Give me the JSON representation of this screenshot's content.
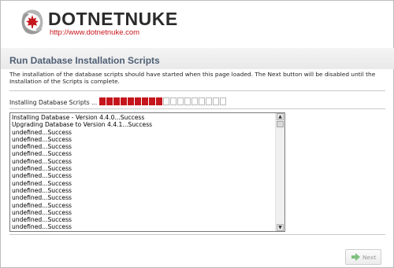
{
  "header": {
    "logo_text": "DOTNETNUKE",
    "logo_url": "http://www.dotnetnuke.com",
    "logo_icon": "dotnetnuke-logo-icon",
    "brand_color": "#c4161c"
  },
  "page": {
    "title": "Run Database Installation Scripts",
    "description": "The installation of the database scripts should have started when this page loaded. The Next button will be disabled until the Installation of the Scripts is complete."
  },
  "progress": {
    "label": "Installing Database Scripts ...",
    "total_blocks": 18,
    "filled_blocks": 9,
    "filled_color": "#c4161c"
  },
  "log": {
    "lines": [
      "Installing Database - Version 4.4.0...Success",
      "Upgrading Database to Version 4.4.1...Success",
      "undefined...Success",
      "undefined...Success",
      "undefined...Success",
      "undefined...Success",
      "undefined...Success",
      "undefined...Success",
      "undefined...Success",
      "undefined...Success",
      "undefined...Success",
      "undefined...Success",
      "undefined...Success",
      "undefined...Success",
      "undefined...Success",
      "undefined...Success"
    ]
  },
  "footer": {
    "next_label": "Next",
    "next_enabled": false,
    "next_icon": "next-arrow-icon"
  }
}
